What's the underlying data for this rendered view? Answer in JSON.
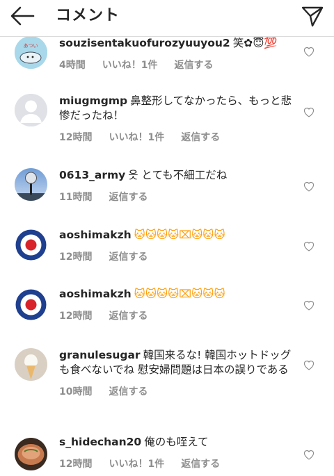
{
  "header": {
    "title": "コメント"
  },
  "comments": [
    {
      "username": "souzisentakuofurozyuuyou2",
      "text": "笑✿😇💯",
      "time": "4時間",
      "likes": "いいね！1件",
      "reply": "返信する"
    },
    {
      "username": "miugmgmp",
      "text": "鼻整形してなかったら、もっと悲惨だったね！",
      "time": "12時間",
      "likes": "いいね！1件",
      "reply": "返信する"
    },
    {
      "username": "0613_army",
      "text": "읏 とても不細工だね",
      "time": "11時間",
      "likes": "",
      "reply": "返信する"
    },
    {
      "username": "aoshimakzh",
      "text": "🐱🐱🐱🐱⌧🐱🐱🐱",
      "time": "12時間",
      "likes": "",
      "reply": "返信する"
    },
    {
      "username": "aoshimakzh",
      "text": "🐱🐱🐱🐱⌧🐱🐱🐱",
      "time": "12時間",
      "likes": "",
      "reply": "返信する"
    },
    {
      "username": "granulesugar",
      "text": "韓国来るな! 韓国ホットドッグも食べないでね 慰安婦問題は日本の誤りである",
      "time": "10時間",
      "likes": "",
      "reply": "返信する"
    },
    {
      "username": "s_hidechan20",
      "text": "俺のも咥えて",
      "time": "12時間",
      "likes": "いいね！1件",
      "reply": "返信する"
    }
  ],
  "icons": {
    "back": "arrow-left-icon",
    "direct": "paper-plane-icon",
    "like": "heart-outline-icon"
  },
  "colors": {
    "text": "#262626",
    "meta": "#8e8e8e",
    "divider": "#dbdbdb",
    "target_red": "#d8232a",
    "target_blue": "#1f3f8f"
  }
}
